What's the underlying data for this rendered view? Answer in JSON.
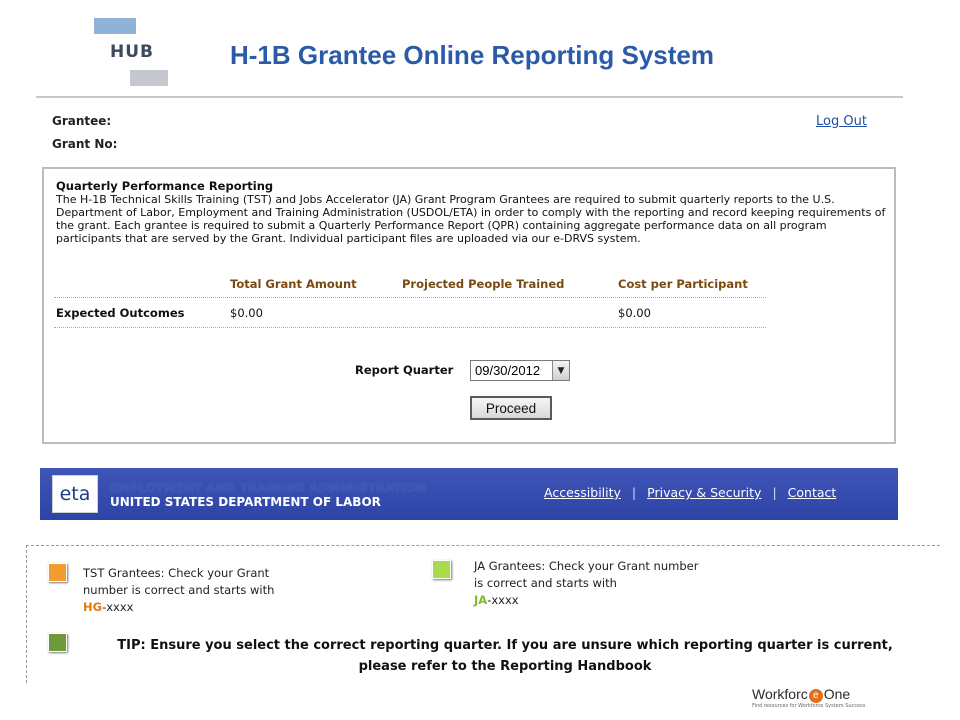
{
  "header": {
    "logo_text": "HUB",
    "title": "H-1B Grantee Online Reporting System"
  },
  "grantee_info": {
    "grantee_label": "Grantee:",
    "grant_no_label": "Grant No:",
    "logout_label": "Log Out"
  },
  "qpr": {
    "heading": "Quarterly Performance Reporting",
    "description": "The H-1B Technical Skills Training (TST) and Jobs Accelerator (JA) Grant Program Grantees are required to submit quarterly reports to the U.S. Department of Labor, Employment and Training Administration (USDOL/ETA) in order to comply with the reporting and record keeping requirements of the grant. Each grantee is required to submit a Quarterly Performance Report (QPR) containing aggregate performance data on all program participants that are served by the Grant. Individual participant files are uploaded via our e-DRVS system.",
    "table": {
      "headers": [
        "Total Grant Amount",
        "Projected People Trained",
        "Cost per Participant"
      ],
      "rows": [
        {
          "label": "Expected Outcomes",
          "total": "$0.00",
          "people": "",
          "cost": "$0.00"
        }
      ]
    },
    "report_quarter_label": "Report Quarter",
    "report_quarter_value": "09/30/2012",
    "proceed_label": "Proceed"
  },
  "footer_banner": {
    "logo_text": "eta",
    "line1": "EMPLOYMENT AND TRAINING ADMINISTRATION",
    "line2": "UNITED STATES DEPARTMENT OF LABOR",
    "links": [
      "Accessibility",
      "Privacy & Security",
      "Contact"
    ],
    "separator": "|"
  },
  "annotations": {
    "tst_note": "TST Grantees:  Check your Grant number is correct and starts with",
    "tst_prefix": "HG",
    "tst_suffix": "-xxxx",
    "ja_note": "JA Grantees:  Check your Grant number is correct and starts with",
    "ja_prefix": "JA",
    "ja_suffix": "-xxxx",
    "tip": "TIP:  Ensure you select the correct reporting quarter.  If you are unsure which reporting quarter is current, please refer to the Reporting Handbook"
  },
  "brand": {
    "name_part1": "Workforc",
    "name_mark": "e",
    "name_part2": "One",
    "tagline": "Find resources for Workforce System Success"
  },
  "colors": {
    "title_blue": "#2a5aa8",
    "link_blue": "#1f4fa6",
    "banner_blue": "#2d43a6",
    "table_header_brown": "#7a4a10",
    "swatch_orange": "#f29b2e",
    "swatch_lime": "#a8dc4c",
    "swatch_green": "#6f9a3a"
  }
}
